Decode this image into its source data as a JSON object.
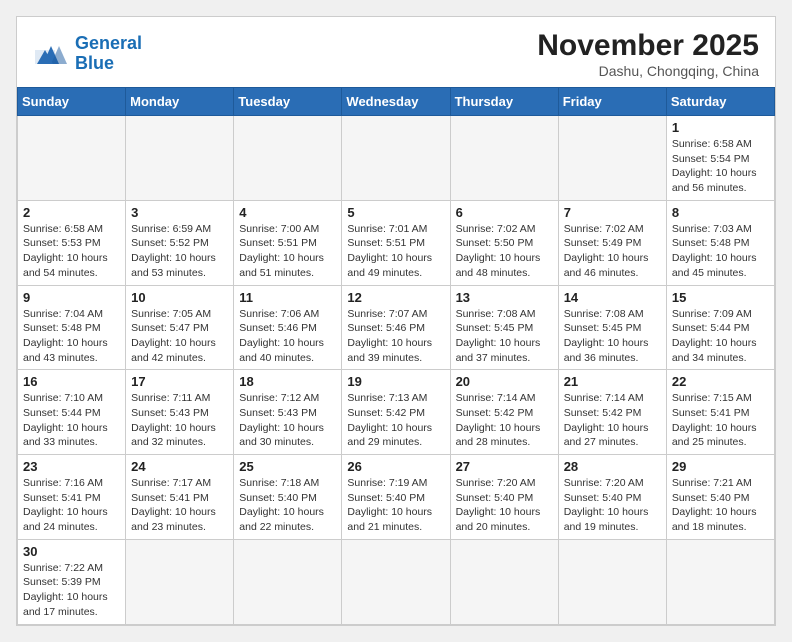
{
  "header": {
    "logo_general": "General",
    "logo_blue": "Blue",
    "month_title": "November 2025",
    "location": "Dashu, Chongqing, China"
  },
  "weekdays": [
    "Sunday",
    "Monday",
    "Tuesday",
    "Wednesday",
    "Thursday",
    "Friday",
    "Saturday"
  ],
  "weeks": [
    [
      {
        "day": "",
        "info": ""
      },
      {
        "day": "",
        "info": ""
      },
      {
        "day": "",
        "info": ""
      },
      {
        "day": "",
        "info": ""
      },
      {
        "day": "",
        "info": ""
      },
      {
        "day": "",
        "info": ""
      },
      {
        "day": "1",
        "info": "Sunrise: 6:58 AM\nSunset: 5:54 PM\nDaylight: 10 hours and 56 minutes."
      }
    ],
    [
      {
        "day": "2",
        "info": "Sunrise: 6:58 AM\nSunset: 5:53 PM\nDaylight: 10 hours and 54 minutes."
      },
      {
        "day": "3",
        "info": "Sunrise: 6:59 AM\nSunset: 5:52 PM\nDaylight: 10 hours and 53 minutes."
      },
      {
        "day": "4",
        "info": "Sunrise: 7:00 AM\nSunset: 5:51 PM\nDaylight: 10 hours and 51 minutes."
      },
      {
        "day": "5",
        "info": "Sunrise: 7:01 AM\nSunset: 5:51 PM\nDaylight: 10 hours and 49 minutes."
      },
      {
        "day": "6",
        "info": "Sunrise: 7:02 AM\nSunset: 5:50 PM\nDaylight: 10 hours and 48 minutes."
      },
      {
        "day": "7",
        "info": "Sunrise: 7:02 AM\nSunset: 5:49 PM\nDaylight: 10 hours and 46 minutes."
      },
      {
        "day": "8",
        "info": "Sunrise: 7:03 AM\nSunset: 5:48 PM\nDaylight: 10 hours and 45 minutes."
      }
    ],
    [
      {
        "day": "9",
        "info": "Sunrise: 7:04 AM\nSunset: 5:48 PM\nDaylight: 10 hours and 43 minutes."
      },
      {
        "day": "10",
        "info": "Sunrise: 7:05 AM\nSunset: 5:47 PM\nDaylight: 10 hours and 42 minutes."
      },
      {
        "day": "11",
        "info": "Sunrise: 7:06 AM\nSunset: 5:46 PM\nDaylight: 10 hours and 40 minutes."
      },
      {
        "day": "12",
        "info": "Sunrise: 7:07 AM\nSunset: 5:46 PM\nDaylight: 10 hours and 39 minutes."
      },
      {
        "day": "13",
        "info": "Sunrise: 7:08 AM\nSunset: 5:45 PM\nDaylight: 10 hours and 37 minutes."
      },
      {
        "day": "14",
        "info": "Sunrise: 7:08 AM\nSunset: 5:45 PM\nDaylight: 10 hours and 36 minutes."
      },
      {
        "day": "15",
        "info": "Sunrise: 7:09 AM\nSunset: 5:44 PM\nDaylight: 10 hours and 34 minutes."
      }
    ],
    [
      {
        "day": "16",
        "info": "Sunrise: 7:10 AM\nSunset: 5:44 PM\nDaylight: 10 hours and 33 minutes."
      },
      {
        "day": "17",
        "info": "Sunrise: 7:11 AM\nSunset: 5:43 PM\nDaylight: 10 hours and 32 minutes."
      },
      {
        "day": "18",
        "info": "Sunrise: 7:12 AM\nSunset: 5:43 PM\nDaylight: 10 hours and 30 minutes."
      },
      {
        "day": "19",
        "info": "Sunrise: 7:13 AM\nSunset: 5:42 PM\nDaylight: 10 hours and 29 minutes."
      },
      {
        "day": "20",
        "info": "Sunrise: 7:14 AM\nSunset: 5:42 PM\nDaylight: 10 hours and 28 minutes."
      },
      {
        "day": "21",
        "info": "Sunrise: 7:14 AM\nSunset: 5:42 PM\nDaylight: 10 hours and 27 minutes."
      },
      {
        "day": "22",
        "info": "Sunrise: 7:15 AM\nSunset: 5:41 PM\nDaylight: 10 hours and 25 minutes."
      }
    ],
    [
      {
        "day": "23",
        "info": "Sunrise: 7:16 AM\nSunset: 5:41 PM\nDaylight: 10 hours and 24 minutes."
      },
      {
        "day": "24",
        "info": "Sunrise: 7:17 AM\nSunset: 5:41 PM\nDaylight: 10 hours and 23 minutes."
      },
      {
        "day": "25",
        "info": "Sunrise: 7:18 AM\nSunset: 5:40 PM\nDaylight: 10 hours and 22 minutes."
      },
      {
        "day": "26",
        "info": "Sunrise: 7:19 AM\nSunset: 5:40 PM\nDaylight: 10 hours and 21 minutes."
      },
      {
        "day": "27",
        "info": "Sunrise: 7:20 AM\nSunset: 5:40 PM\nDaylight: 10 hours and 20 minutes."
      },
      {
        "day": "28",
        "info": "Sunrise: 7:20 AM\nSunset: 5:40 PM\nDaylight: 10 hours and 19 minutes."
      },
      {
        "day": "29",
        "info": "Sunrise: 7:21 AM\nSunset: 5:40 PM\nDaylight: 10 hours and 18 minutes."
      }
    ],
    [
      {
        "day": "30",
        "info": "Sunrise: 7:22 AM\nSunset: 5:39 PM\nDaylight: 10 hours and 17 minutes."
      },
      {
        "day": "",
        "info": ""
      },
      {
        "day": "",
        "info": ""
      },
      {
        "day": "",
        "info": ""
      },
      {
        "day": "",
        "info": ""
      },
      {
        "day": "",
        "info": ""
      },
      {
        "day": "",
        "info": ""
      }
    ]
  ]
}
